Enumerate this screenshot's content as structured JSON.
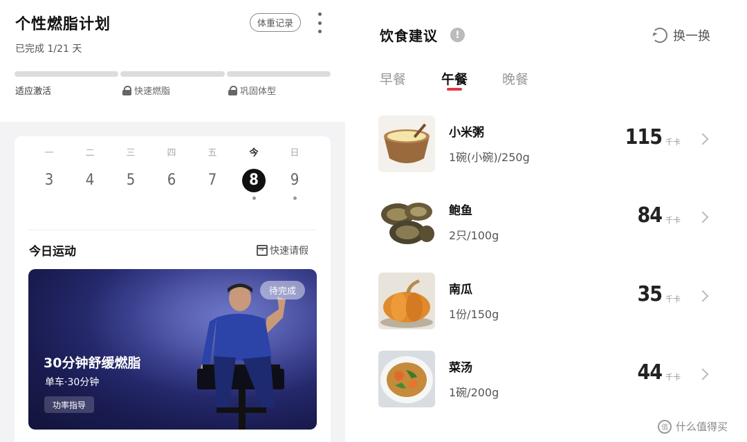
{
  "plan": {
    "title": "个性燃脂计划",
    "progress": "已完成 1/21 天",
    "weight_button": "体重记录",
    "stages": [
      {
        "label": "适应激活",
        "locked": false
      },
      {
        "label": "快速燃脂",
        "locked": true
      },
      {
        "label": "巩固体型",
        "locked": true
      }
    ]
  },
  "week": {
    "days": [
      {
        "name": "一",
        "num": "3",
        "dot": false,
        "today": false
      },
      {
        "name": "二",
        "num": "4",
        "dot": false,
        "today": false
      },
      {
        "name": "三",
        "num": "5",
        "dot": false,
        "today": false
      },
      {
        "name": "四",
        "num": "6",
        "dot": false,
        "today": false
      },
      {
        "name": "五",
        "num": "7",
        "dot": false,
        "today": false
      },
      {
        "name": "今",
        "num": "8",
        "dot": true,
        "today": true
      },
      {
        "name": "日",
        "num": "9",
        "dot": true,
        "today": false
      }
    ]
  },
  "exercise": {
    "title": "今日运动",
    "leave_button": "快速请假",
    "workout": {
      "status": "待完成",
      "name": "30分钟舒缓燃脂",
      "meta": "单车·30分钟",
      "tag": "功率指导"
    }
  },
  "diet": {
    "title": "饮食建议",
    "info_icon": "!",
    "swap_button": "换一换",
    "tabs": [
      "早餐",
      "午餐",
      "晚餐"
    ],
    "active_tab": "午餐",
    "kcal_unit": "千卡",
    "foods": [
      {
        "name": "小米粥",
        "amount": "1碗(小碗)/250g",
        "kcal": "115",
        "image": "millet-porridge-image"
      },
      {
        "name": "鲍鱼",
        "amount": "2只/100g",
        "kcal": "84",
        "image": "abalone-image"
      },
      {
        "name": "南瓜",
        "amount": "1份/150g",
        "kcal": "35",
        "image": "pumpkin-image"
      },
      {
        "name": "菜汤",
        "amount": "1碗/200g",
        "kcal": "44",
        "image": "vegetable-soup-image"
      }
    ]
  },
  "watermark": {
    "text": "什么值得买",
    "icon": "值"
  }
}
